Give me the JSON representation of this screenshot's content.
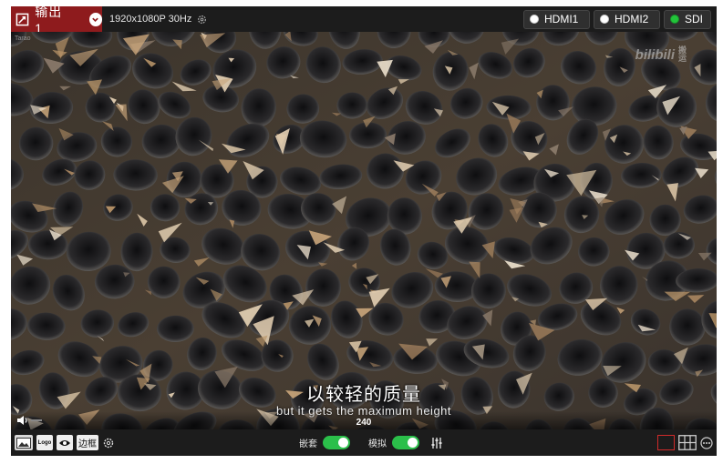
{
  "header": {
    "output_title": "输出 1",
    "resolution": "1920x1080P 30Hz",
    "inputs": [
      {
        "label": "HDMI1",
        "active": false
      },
      {
        "label": "HDMI2",
        "active": false
      },
      {
        "label": "SDI",
        "active": true
      }
    ]
  },
  "preview": {
    "corner_label": "Tarao",
    "watermark_logo": "bilibili",
    "watermark_text": "搬运",
    "subtitle_cn": "以较轻的质量",
    "subtitle_en": "but it gets the maximum height",
    "level_value": "240"
  },
  "footer": {
    "logo_label": "Logo",
    "border_label": "边框",
    "embed_label": "嵌套",
    "embed_on": true,
    "analog_label": "模拟",
    "analog_on": true
  },
  "colors": {
    "output_tab": "#8e1b1d",
    "active_input": "#22c43a",
    "toggle_on": "#2bbf4a",
    "layout_selected": "#cf2a2a"
  }
}
